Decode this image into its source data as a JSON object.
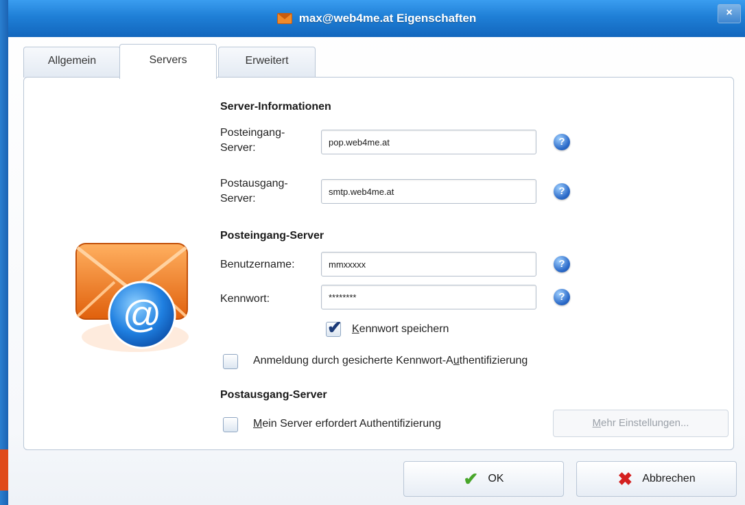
{
  "window": {
    "title": "max@web4me.at Eigenschaften",
    "close_symbol": "×"
  },
  "tabs": [
    {
      "label": "Allgemein",
      "active": false
    },
    {
      "label": "Servers",
      "active": true
    },
    {
      "label": "Erweitert",
      "active": false
    }
  ],
  "server_info": {
    "heading": "Server-Informationen",
    "incoming_label_1": "Posteingang-",
    "incoming_label_2": "Server:",
    "incoming_value": "pop.web4me.at",
    "outgoing_label_1": "Postausgang-",
    "outgoing_label_2": "Server:",
    "outgoing_value": "smtp.web4me.at"
  },
  "incoming": {
    "heading": "Posteingang-Server",
    "username_label": "Benutzername:",
    "username_value": "mmxxxxx",
    "password_label": "Kennwort:",
    "password_value": "********",
    "save_password_prefix": "K",
    "save_password_rest": "ennwort speichern",
    "save_password_checked": true,
    "spa_label_a": "Anmeldung durch gesicherte Kennwort-A",
    "spa_label_b": "u",
    "spa_label_c": "thentifizierung",
    "spa_checked": false
  },
  "outgoing": {
    "heading": "Postausgang-Server",
    "auth_prefix": "M",
    "auth_rest": "ein Server erfordert Authentifizierung",
    "auth_checked": false,
    "more_settings_prefix": "M",
    "more_settings_rest": "ehr Einstellungen..."
  },
  "buttons": {
    "ok": "OK",
    "cancel": "Abbrechen"
  },
  "icons": {
    "help": "?",
    "ok": "✔",
    "cancel": "✖",
    "check": "✔"
  }
}
